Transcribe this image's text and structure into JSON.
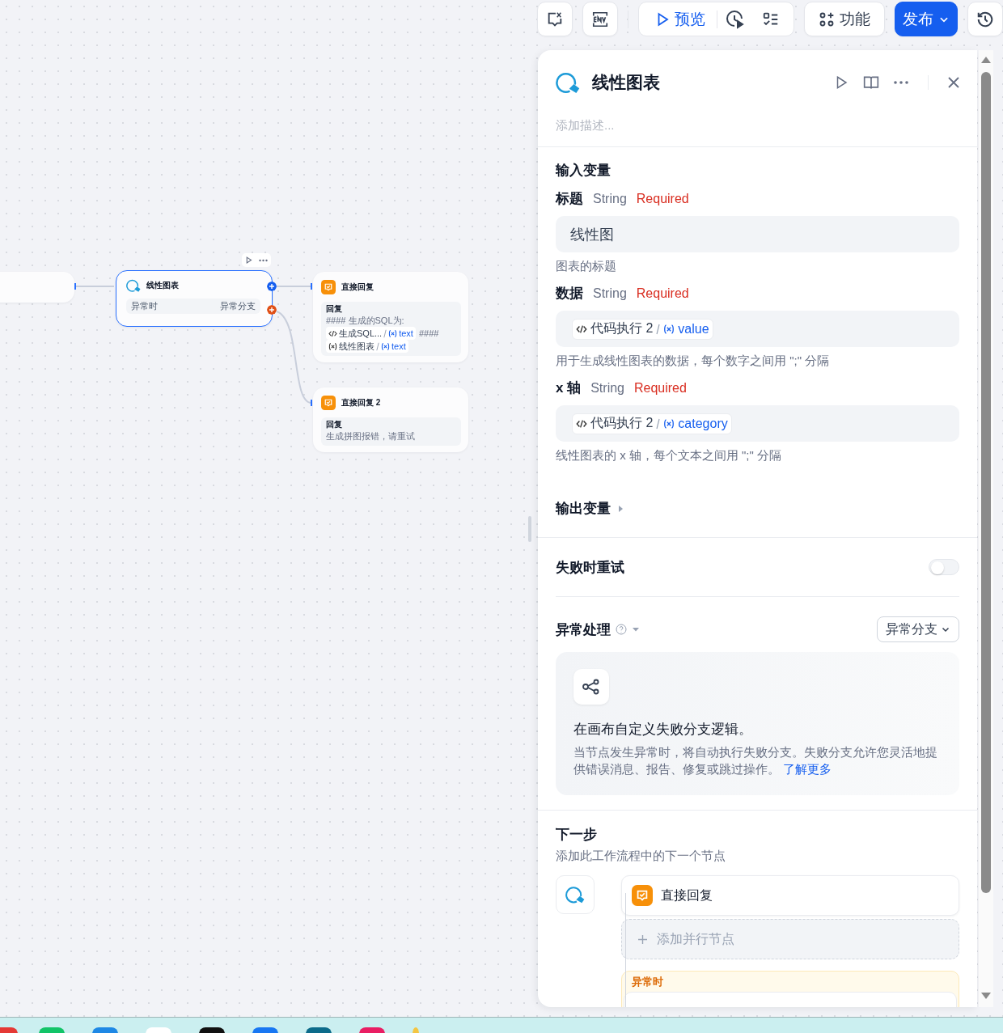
{
  "toolbar": {
    "preview": "预览",
    "features": "功能",
    "publish": "发布"
  },
  "canvas": {
    "chart_node": {
      "title": "线性图表",
      "exception_label": "异常时",
      "exception_value": "异常分支",
      "selected": true
    },
    "reply_nodes": [
      {
        "title": "直接回复",
        "field_label": "回复",
        "lines": [
          [
            {
              "kind": "text",
              "text": "#### 生成的SQL为:"
            }
          ],
          [
            {
              "kind": "code_chip",
              "source": "生成SQL...",
              "var": "text"
            },
            {
              "kind": "text",
              "text": "####"
            }
          ],
          [
            {
              "kind": "var_chip",
              "source": "线性图表",
              "var": "text"
            }
          ]
        ]
      },
      {
        "title": "直接回复 2",
        "field_label": "回复",
        "lines": [
          [
            {
              "kind": "text",
              "text": "生成拼图报错，请重试"
            }
          ]
        ]
      }
    ]
  },
  "panel": {
    "title": "线性图表",
    "description_placeholder": "添加描述...",
    "input_title": "输入变量",
    "inputs": [
      {
        "label": "标题",
        "type": "String",
        "required": "Required",
        "value": {
          "kind": "text",
          "text": "线性图"
        },
        "hint": "图表的标题"
      },
      {
        "label": "数据",
        "type": "String",
        "required": "Required",
        "value": {
          "kind": "ref",
          "source": "代码执行 2",
          "var": "value"
        },
        "hint": "用于生成线性图表的数据，每个数字之间用 \";\" 分隔"
      },
      {
        "label": "x 轴",
        "type": "String",
        "required": "Required",
        "value": {
          "kind": "ref",
          "source": "代码执行 2",
          "var": "category"
        },
        "hint": "线性图表的 x 轴，每个文本之间用 \";\" 分隔"
      }
    ],
    "output": {
      "title": "输出变量",
      "expanded": false
    },
    "retry": {
      "label": "失败时重试",
      "on": false
    },
    "exception": {
      "label": "异常处理",
      "select": "异常分支",
      "card_title": "在画布自定义失败分支逻辑。",
      "card_text": "当节点发生异常时，将自动执行失败分支。失败分支允许您灵活地提供错误消息、报告、修复或跳过操作。",
      "card_link": "了解更多"
    },
    "next_step": {
      "title": "下一步",
      "subtitle": "添加此工作流程中的下一个节点",
      "nodes": [
        {
          "title": "直接回复"
        }
      ],
      "add_parallel": "添加并行节点",
      "exception_label": "异常时"
    }
  }
}
